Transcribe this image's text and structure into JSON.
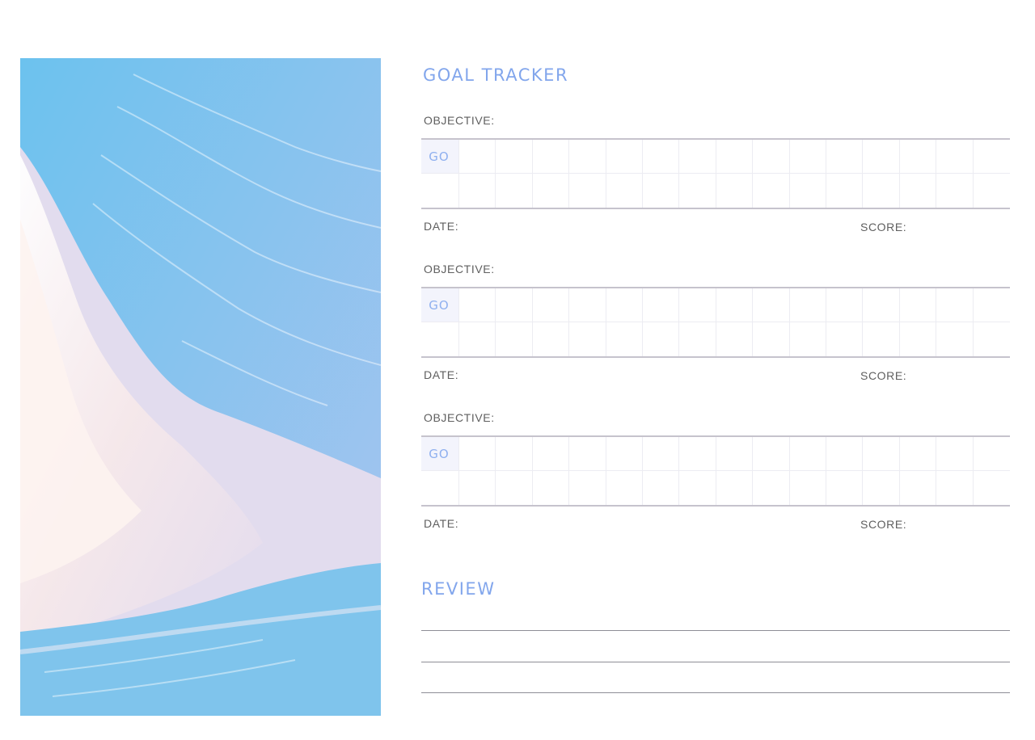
{
  "title": "GOAL TRACKER",
  "goals": [
    {
      "objective_label": "OBJECTIVE:",
      "go_label": "GO",
      "date_label": "DATE:",
      "score_label": "SCORE:"
    },
    {
      "objective_label": "OBJECTIVE:",
      "go_label": "GO",
      "date_label": "DATE:",
      "score_label": "SCORE:"
    },
    {
      "objective_label": "OBJECTIVE:",
      "go_label": "GO",
      "date_label": "DATE:",
      "score_label": "SCORE:"
    }
  ],
  "review": {
    "title": "REVIEW",
    "line_count": 3
  },
  "colors": {
    "accent": "#82a6ec",
    "label": "#5f5f5f",
    "rule": "#c6c3cd",
    "go_cell_bg": "#f3f4fc"
  }
}
